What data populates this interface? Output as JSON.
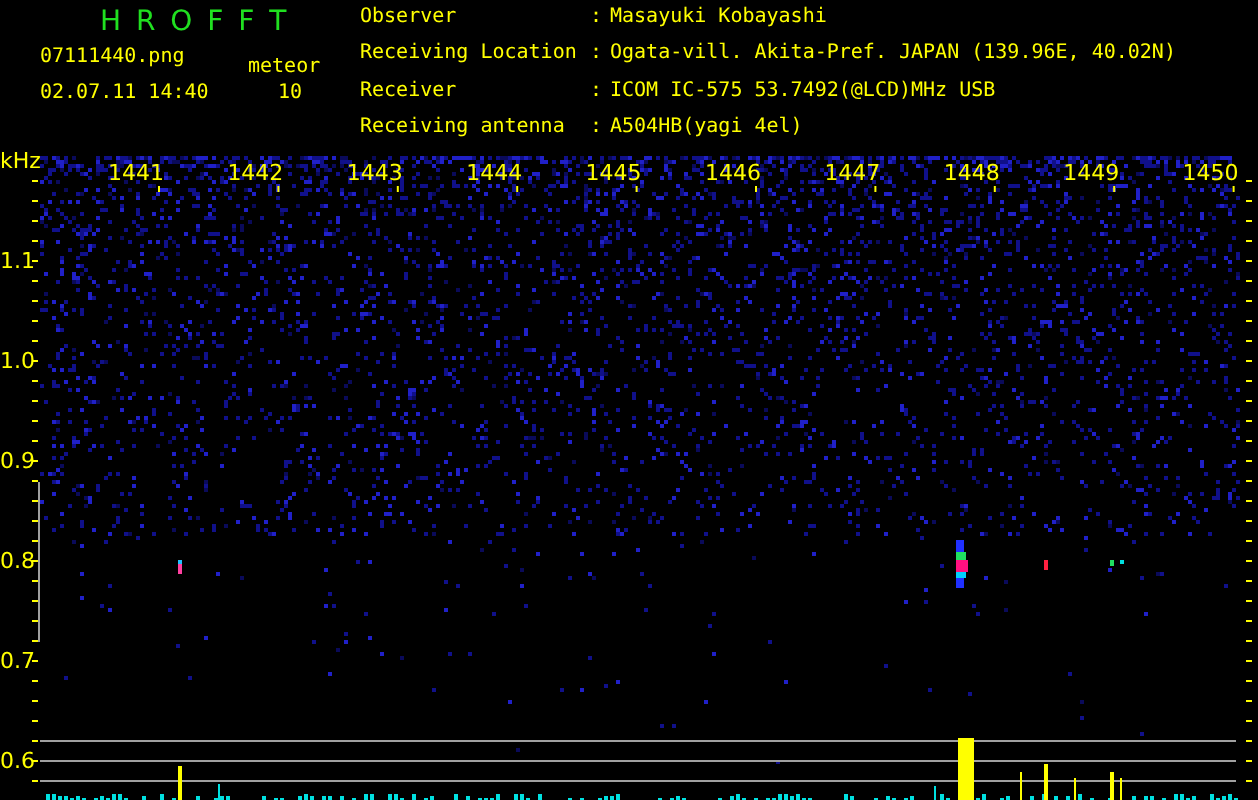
{
  "header": {
    "title": "H R O F F T",
    "filename": "07111440.png",
    "date_time": "02.07.11 14:40",
    "meteor_label": "meteor",
    "meteor_count": "10"
  },
  "info": [
    {
      "label": "Observer",
      "separator": ":",
      "value": "Masayuki Kobayashi"
    },
    {
      "label": "Receiving Location",
      "separator": ":",
      "value": "Ogata-vill. Akita-Pref. JAPAN (139.96E, 40.02N)"
    },
    {
      "label": "Receiver",
      "separator": ":",
      "value": "ICOM IC-575 53.7492(@LCD)MHz USB"
    },
    {
      "label": "Receiving antenna",
      "separator": ":",
      "value": "A504HB(yagi 4el)"
    }
  ],
  "axis": {
    "unit": "kHz",
    "x_labels": [
      "1441",
      "1442",
      "1443",
      "1444",
      "1445",
      "1446",
      "1447",
      "1448",
      "1449",
      "1450"
    ],
    "y_labels": [
      "1.1",
      "1.0",
      "0.9",
      "0.8",
      "0.7",
      "0.6"
    ]
  }
}
